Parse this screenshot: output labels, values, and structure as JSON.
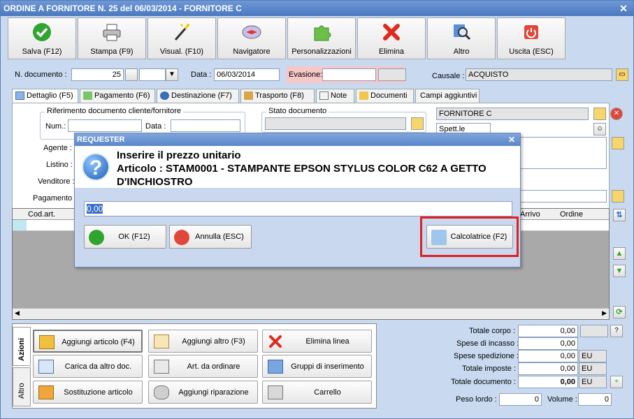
{
  "window": {
    "title": "ORDINE A FORNITORE N. 25 del 06/03/2014 - FORNITORE C"
  },
  "toolbar": [
    {
      "label": "Salva (F12)",
      "icon": "check-icon"
    },
    {
      "label": "Stampa (F9)",
      "icon": "printer-icon"
    },
    {
      "label": "Visual. (F10)",
      "icon": "magic-wand-icon"
    },
    {
      "label": "Navigatore",
      "icon": "compass-icon"
    },
    {
      "label": "Personalizzazioni",
      "icon": "puzzle-icon"
    },
    {
      "label": "Elimina",
      "icon": "delete-icon"
    },
    {
      "label": "Altro",
      "icon": "magnifier-icon"
    },
    {
      "label": "Uscita (ESC)",
      "icon": "power-icon"
    }
  ],
  "header": {
    "ndoc_label": "N. documento :",
    "ndoc_value": "25",
    "data_label": "Data :",
    "data_value": "06/03/2014",
    "evasione_label": "Evasione:",
    "causale_label": "Causale :",
    "causale_value": "ACQUISTO"
  },
  "tabs": [
    "Dettaglio (F5)",
    "Pagamento (F6)",
    "Destinazione (F7)",
    "Trasporto (F8)",
    "Note",
    "Documenti",
    "Campi aggiuntivi"
  ],
  "detail": {
    "rif_title": "Riferimento documento cliente/fornitore",
    "num_label": "Num.:",
    "data_label": "Data :",
    "stato_title": "Stato documento",
    "agente_label": "Agente :",
    "listino_label": "Listino :",
    "venditore_label": "Venditore :",
    "pagamento_label": "Pagamento :",
    "fornitore": "FORNITORE C",
    "spett": "Spett.le"
  },
  "grid": {
    "columns": [
      "Cod.art.",
      "Arrivo",
      "Ordine"
    ]
  },
  "actions": {
    "tab_azioni": "Azioni",
    "tab_altro": "Altro",
    "buttons": [
      {
        "label": "Aggiungi articolo (F4)",
        "icon": "add-box-icon"
      },
      {
        "label": "Aggiungi altro (F3)",
        "icon": "add-grid-icon"
      },
      {
        "label": "Elimina linea",
        "icon": "delete-line-icon"
      },
      {
        "label": "Carica da altro doc.",
        "icon": "load-doc-icon"
      },
      {
        "label": "Art. da ordinare",
        "icon": "order-article-icon"
      },
      {
        "label": "Gruppi di inserimento",
        "icon": "group-insert-icon"
      },
      {
        "label": "Sostituzione articolo",
        "icon": "replace-article-icon"
      },
      {
        "label": "Aggiungi riparazione",
        "icon": "wrench-icon"
      },
      {
        "label": "Carrello",
        "icon": "cart-icon"
      }
    ]
  },
  "totals": {
    "corpo_label": "Totale corpo :",
    "corpo": "0,00",
    "incasso_label": "Spese di incasso :",
    "incasso": "0,00",
    "spedizione_label": "Spese spedizione :",
    "spedizione": "0,00",
    "spedizione_cur": "EU",
    "imposte_label": "Totale imposte :",
    "imposte": "0,00",
    "imposte_cur": "EU",
    "documento_label": "Totale documento :",
    "documento": "0,00",
    "documento_cur": "EU",
    "peso_label": "Peso lordo :",
    "peso": "0",
    "volume_label": "Volume :",
    "volume": "0",
    "help": "?"
  },
  "dialog": {
    "title": "REQUESTER",
    "line1": "Inserire il prezzo unitario",
    "line2": "Articolo : STAM0001 - STAMPANTE EPSON STYLUS COLOR C62 A GETTO D'INCHIOSTRO",
    "value": "0,00",
    "ok": "OK (F12)",
    "cancel": "Annulla (ESC)",
    "calc": "Calcolatrice (F2)"
  },
  "colors": {
    "highlight": "#e02020",
    "title": "#4a78c0",
    "evasione_bg": "#f7c7c7"
  }
}
